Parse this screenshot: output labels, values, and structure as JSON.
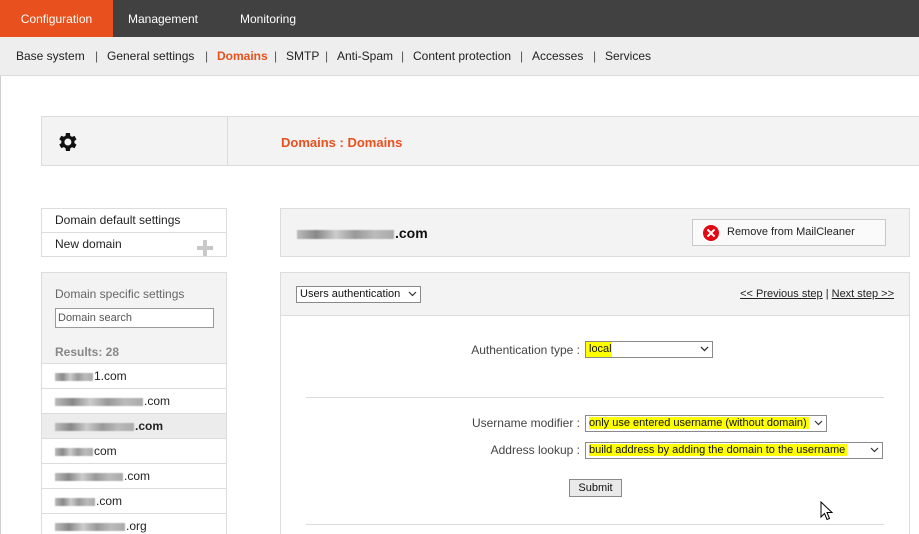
{
  "topnav": {
    "tabs": [
      {
        "label": "Configuration",
        "active": true
      },
      {
        "label": "Management",
        "active": false
      },
      {
        "label": "Monitoring",
        "active": false
      }
    ]
  },
  "subnav": {
    "items": [
      {
        "label": "Base system",
        "active": false
      },
      {
        "label": "General settings",
        "active": false
      },
      {
        "label": "Domains",
        "active": true
      },
      {
        "label": "SMTP",
        "active": false
      },
      {
        "label": "Anti-Spam",
        "active": false
      },
      {
        "label": "Content protection",
        "active": false
      },
      {
        "label": "Accesses",
        "active": false
      },
      {
        "label": "Services",
        "active": false
      }
    ],
    "separator": "|"
  },
  "header": {
    "icon": "gear-icon",
    "breadcrumb": "Domains : Domains"
  },
  "leftmenu": {
    "default_settings": "Domain default settings",
    "new_domain": "New domain"
  },
  "specific": {
    "title": "Domain specific settings",
    "search_placeholder": "Domain search",
    "results": "Results: 28",
    "domains": [
      {
        "suffix": "1.com",
        "selected": false
      },
      {
        "suffix": ".com",
        "selected": false
      },
      {
        "suffix": ".com",
        "selected": true
      },
      {
        "suffix": "com",
        "selected": false
      },
      {
        "suffix": ".com",
        "selected": false
      },
      {
        "suffix": ".com",
        "selected": false
      },
      {
        "suffix": ".org",
        "selected": false
      }
    ]
  },
  "domain": {
    "name_suffix": ".com",
    "remove_label": "Remove from MailCleaner"
  },
  "panel": {
    "section_select": "Users authentication",
    "prev_step": "<< Previous step",
    "step_sep": "|",
    "next_step": "Next step >>",
    "auth_type_label": "Authentication type :",
    "auth_type_value": "local",
    "username_modifier_label": "Username modifier :",
    "username_modifier_value": "only use entered username (without domain)",
    "address_lookup_label": "Address lookup :",
    "address_lookup_value": "build address by adding the domain to the username",
    "submit_label": "Submit"
  },
  "colors": {
    "accent": "#e8501d",
    "topnav_bg": "#414141",
    "highlight": "#ffff00",
    "remove_icon": "#e30613"
  }
}
